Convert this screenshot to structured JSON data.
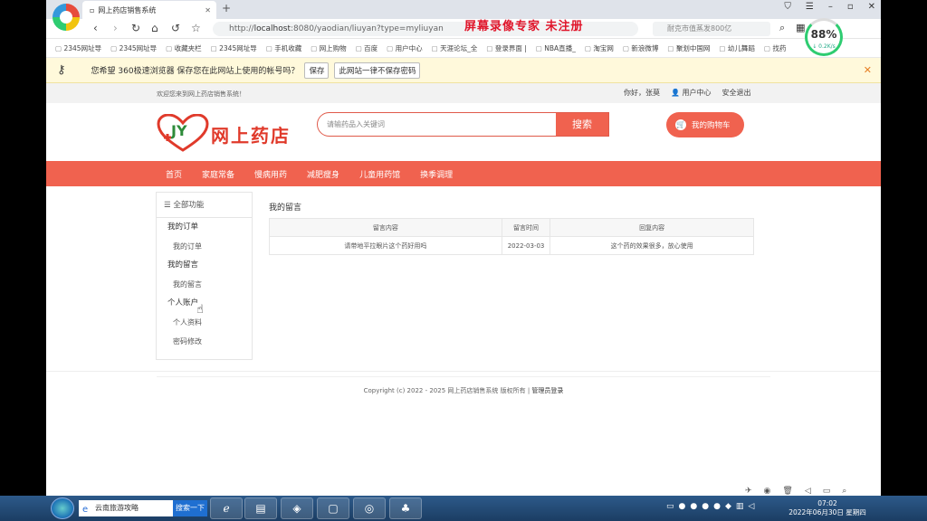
{
  "browser": {
    "tab_title": "网上药店销售系统",
    "url_prefix": "http://",
    "url_host": "localhost",
    "url_rest": ":8080/yaodian/liuyan?type=myliuyan",
    "search_hint": "耐克市值蒸发800亿",
    "speed_percent": "88%",
    "speed_rate": "↓ 0.2K/s",
    "watermark": "屏幕录像专家  未注册"
  },
  "bookmarks": [
    "2345网址导",
    "2345网址导",
    "收藏夹栏",
    "2345网址导",
    "手机收藏",
    "网上购物",
    "百度",
    "用户中心",
    "天涯论坛_全",
    "登录界面 |",
    "NBA直播_",
    "淘宝网",
    "新浪微博",
    "聚划中国网",
    "幼儿舞蹈",
    "找药"
  ],
  "password_bar": {
    "message": "您希望 360极速浏览器 保存您在此网站上使用的帐号吗？",
    "save_label": "保存",
    "never_label": "此网站一律不保存密码"
  },
  "header": {
    "welcome": "欢迎您来到网上药店销售系统！",
    "greeting": "你好，张莫",
    "user_center": "用户中心",
    "logout": "安全退出",
    "logo_text": "网上药店",
    "search_placeholder": "请输药品入关键词",
    "search_button": "搜索",
    "cart_label": "我的购物车"
  },
  "nav": [
    "首页",
    "家庭常备",
    "慢病用药",
    "减肥瘦身",
    "儿童用药馆",
    "换季调理"
  ],
  "sidebar": {
    "title": "全部功能",
    "groups": [
      {
        "label": "我的订单",
        "items": [
          "我的订单"
        ]
      },
      {
        "label": "我的留言",
        "items": [
          "我的留言"
        ]
      },
      {
        "label": "个人账户",
        "items": [
          "个人资料",
          "密码修改"
        ]
      }
    ]
  },
  "main": {
    "title": "我的留言",
    "columns": [
      "留言内容",
      "留言时间",
      "回复内容"
    ],
    "rows": [
      [
        "请带地平拉眼片这个药好用吗",
        "2022-03-03",
        "这个药的效果很多，放心使用"
      ]
    ]
  },
  "footer": {
    "copyright": "Copyright (c) 2022 - 2025 网上药店销售系统 版权所有  |",
    "admin_link": "管理员登录"
  },
  "taskbar": {
    "search_text": "云南旅游攻略",
    "search_button": "搜索一下",
    "time": "07:02",
    "date": "2022年06月30日 星期四"
  }
}
